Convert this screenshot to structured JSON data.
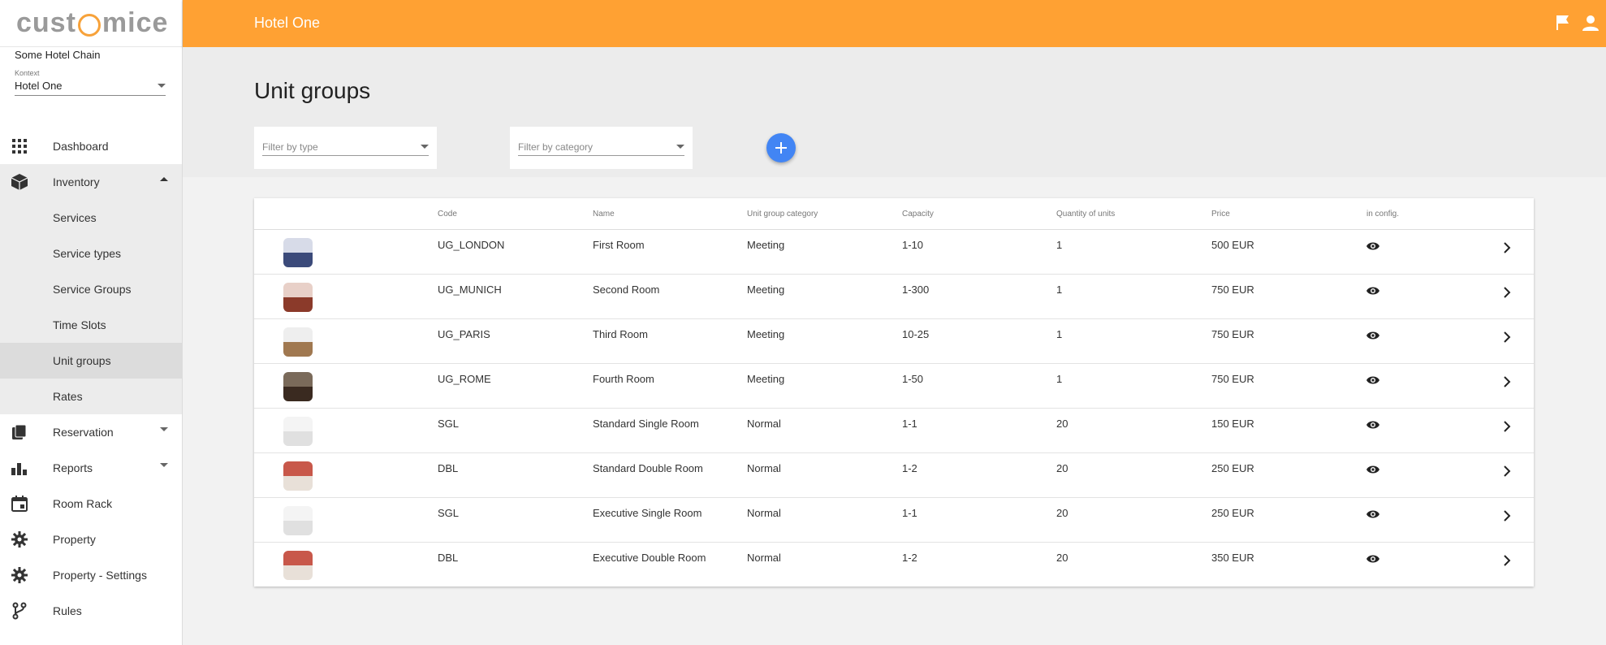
{
  "brand": {
    "logo_left": "cust",
    "logo_right": "mice"
  },
  "sidebar": {
    "chain": "Some Hotel Chain",
    "kontext_label": "Kontext",
    "kontext_value": "Hotel One",
    "items": [
      {
        "label": "Dashboard",
        "icon": "grid-icon"
      },
      {
        "label": "Inventory",
        "icon": "cube-icon"
      },
      {
        "label": "Reservation",
        "icon": "copy-icon"
      },
      {
        "label": "Reports",
        "icon": "bar-chart-icon"
      },
      {
        "label": "Room Rack",
        "icon": "calendar-icon"
      },
      {
        "label": "Property",
        "icon": "gear-icon"
      },
      {
        "label": "Property - Settings",
        "icon": "gear-icon"
      },
      {
        "label": "Rules",
        "icon": "fork-icon"
      }
    ],
    "inventory_sub": [
      "Services",
      "Service types",
      "Service Groups",
      "Time Slots",
      "Unit groups",
      "Rates"
    ]
  },
  "topbar": {
    "title": "Hotel One"
  },
  "page": {
    "title": "Unit groups",
    "filter_type_placeholder": "Filter by type",
    "filter_category_placeholder": "Filter by category"
  },
  "table": {
    "headers": [
      "Code",
      "Name",
      "Unit group category",
      "Capacity",
      "Quantity of units",
      "Price",
      "in config."
    ],
    "rows": [
      {
        "code": "UG_LONDON",
        "name": "First Room",
        "category": "Meeting",
        "capacity": "1-10",
        "quantity": "1",
        "price": "500 EUR",
        "thumb_colors": [
          "#d7dbe8",
          "#3b4a7a"
        ]
      },
      {
        "code": "UG_MUNICH",
        "name": "Second Room",
        "category": "Meeting",
        "capacity": "1-300",
        "quantity": "1",
        "price": "750 EUR",
        "thumb_colors": [
          "#e8d0c8",
          "#8b3a2a"
        ]
      },
      {
        "code": "UG_PARIS",
        "name": "Third Room",
        "category": "Meeting",
        "capacity": "10-25",
        "quantity": "1",
        "price": "750 EUR",
        "thumb_colors": [
          "#eeeeee",
          "#a07850"
        ]
      },
      {
        "code": "UG_ROME",
        "name": "Fourth Room",
        "category": "Meeting",
        "capacity": "1-50",
        "quantity": "1",
        "price": "750 EUR",
        "thumb_colors": [
          "#7a6a5a",
          "#3a2a20"
        ]
      },
      {
        "code": "SGL",
        "name": "Standard Single Room",
        "category": "Normal",
        "capacity": "1-1",
        "quantity": "20",
        "price": "150 EUR",
        "thumb_colors": [
          "#f4f4f4",
          "#e0e0e0"
        ]
      },
      {
        "code": "DBL",
        "name": "Standard Double Room",
        "category": "Normal",
        "capacity": "1-2",
        "quantity": "20",
        "price": "250 EUR",
        "thumb_colors": [
          "#c8584a",
          "#e8e0d8"
        ]
      },
      {
        "code": "SGL",
        "name": "Executive Single Room",
        "category": "Normal",
        "capacity": "1-1",
        "quantity": "20",
        "price": "250 EUR",
        "thumb_colors": [
          "#f4f4f4",
          "#e0e0e0"
        ]
      },
      {
        "code": "DBL",
        "name": "Executive Double Room",
        "category": "Normal",
        "capacity": "1-2",
        "quantity": "20",
        "price": "350 EUR",
        "thumb_colors": [
          "#c8584a",
          "#e8e0d8"
        ]
      }
    ]
  },
  "colors": {
    "accent": "#ffa133",
    "fab": "#4285f4"
  }
}
